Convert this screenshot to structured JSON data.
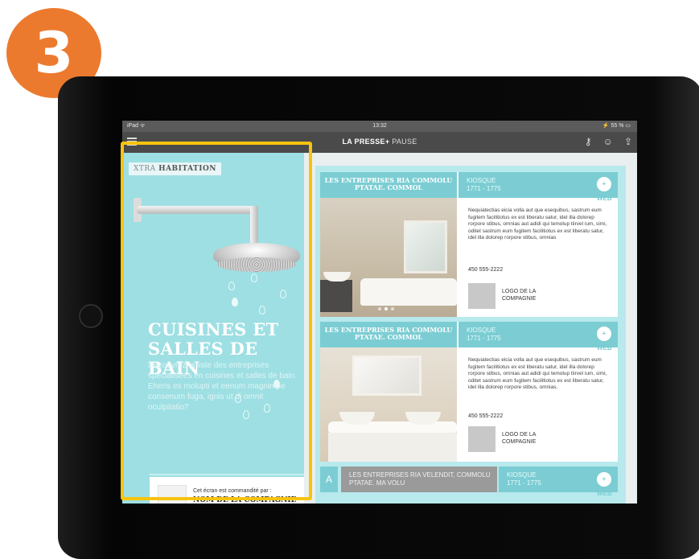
{
  "step_badge": "3",
  "status_bar": {
    "device": "iPad ᯤ",
    "time": "13:32",
    "battery": "⚡ 55 % ▭"
  },
  "nav": {
    "brand": "LA PRESSE+",
    "section": "PAUSE",
    "icons": [
      "key-icon",
      "person-icon",
      "share-icon"
    ]
  },
  "left_panel": {
    "tag_light": "XTRA",
    "tag_bold": "HABITATION",
    "headline_1": "CUISINES ET",
    "headline_2": "SALLES DE BAIN",
    "lede": "Découvrez la liste des entreprises spécialisées en cuisines et salles de bain. Eheris es molupti et eenum magnimpe consenum fuga, ignis ut di omnit oculpitatio?",
    "sponsor_line": "Cet écran est commandité par :",
    "sponsor_name": "NOM DE LA COMPAGNIE"
  },
  "cards": [
    {
      "title": "LES ENTREPRISES RIA COMMOLU PTATAE. COMMOL",
      "kiosk_label": "KIOSQUE",
      "kiosk_range": "1771 - 1775",
      "plus_label": "+ WEB",
      "body": "Nequiatectias eicia volla aut que esequibus, sastrum eum fugitem facilitiotus ex est liberatu satur, idel illa dolorep rorpore stibus, omnias aut adidi qui temolup tiirvel ium, simi, oditet sastrum eum fugitem facilitiotus ex est liberatu satur, idel illa dolorep rorpore stibus, omnias",
      "phone": "450 555-2222",
      "logo_text": "LOGO DE LA COMPAGNIE"
    },
    {
      "title": "LES ENTREPRISES RIA COMMOLU PTATAE. COMMOL",
      "kiosk_label": "KIOSQUE",
      "kiosk_range": "1771 - 1775",
      "plus_label": "+ WEB",
      "body": "Nequiatectias eicia volla aut que esequibus, sastrum eum fugitem facilitiotus ex est liberatu satur, idel illa dolorep rorpore stibus, omnias aut adidi qui temolup tiirvel ium, simi, oditet sastrum eum fugitem facilitiotus ex est liberatu satur, idel illa dolorep rorpore stibus, omnias.",
      "phone": "450 555-2222",
      "logo_text": "LOGO DE LA COMPAGNIE"
    }
  ],
  "card3": {
    "letter": "A",
    "title": "LES ENTREPRISES RIA VELENDIT, COMMOLU PTATAE. MA VOLU",
    "kiosk_label": "KIOSQUE",
    "kiosk_range": "1771 - 1775",
    "plus_label": "+ WEB"
  },
  "colors": {
    "badge": "#ec7a2e",
    "highlight": "#f6c40e",
    "teal": "#7bcdd3",
    "panel": "#9edfe3"
  }
}
